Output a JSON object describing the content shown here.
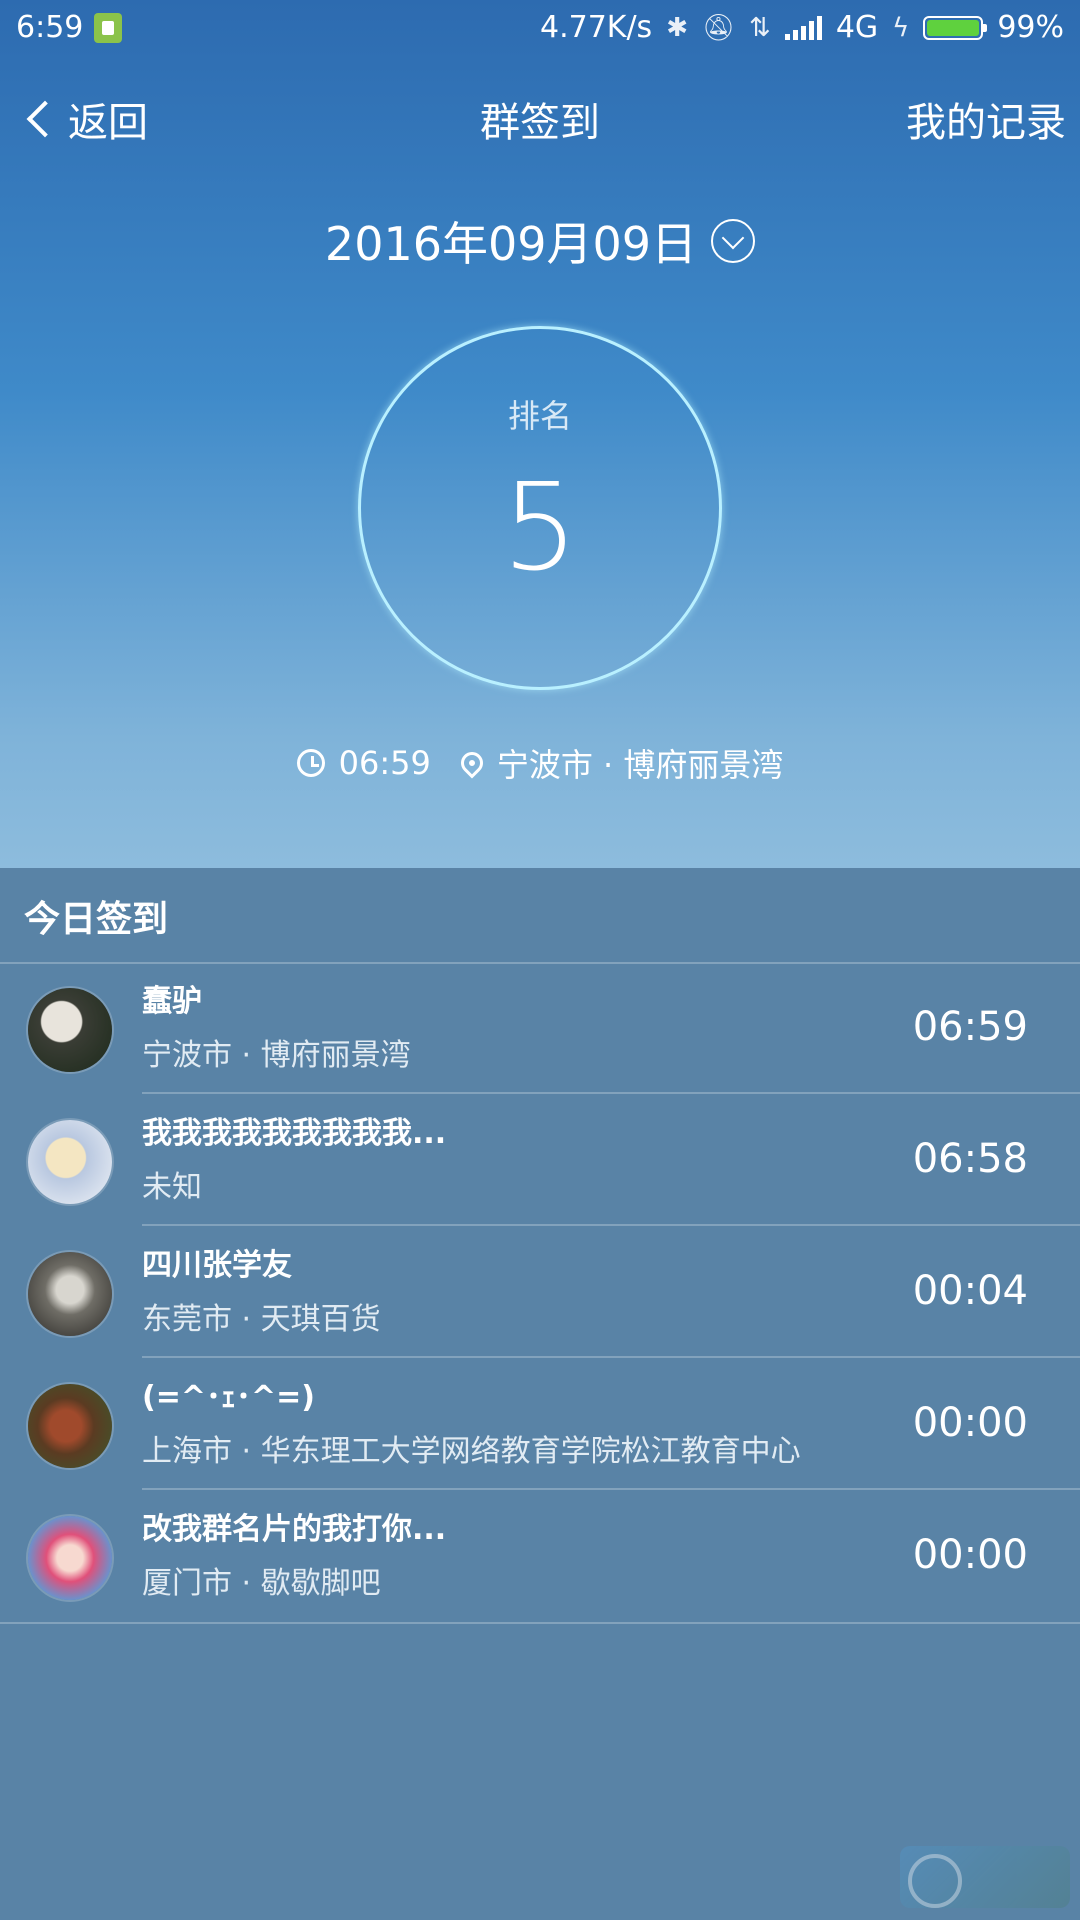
{
  "status_bar": {
    "time": "6:59",
    "network_speed": "4.77K/s",
    "network_type": "4G",
    "battery": "99%",
    "battery_color": "#5fd13e"
  },
  "nav": {
    "back_label": "返回",
    "title": "群签到",
    "records_label": "我的记录"
  },
  "header": {
    "date": "2016年09月09日",
    "rank_label": "排名",
    "rank_value": "5",
    "checkin_time": "06:59",
    "location": "宁波市 · 博府丽景湾"
  },
  "list": {
    "title": "今日签到",
    "rows": [
      {
        "name": "蠢驴",
        "location": "宁波市 · 博府丽景湾",
        "time": "06:59"
      },
      {
        "name": "我我我我我我我我我...",
        "location": "未知",
        "time": "06:58"
      },
      {
        "name": "四川张学友",
        "location": "东莞市 · 天琪百货",
        "time": "00:04"
      },
      {
        "name": "(=^･ｪ･^=)",
        "location": "上海市 · 华东理工大学网络教育学院松江教育中心",
        "time": "00:00"
      },
      {
        "name": "改我群名片的我打你...",
        "location": "厦门市 · 歇歇脚吧",
        "time": "00:00"
      }
    ]
  },
  "colors": {
    "header_top": "#2d6bb0",
    "header_bottom": "#8dbcdd",
    "list_bg": "#5983a6",
    "ring": "#b9f0ff"
  }
}
